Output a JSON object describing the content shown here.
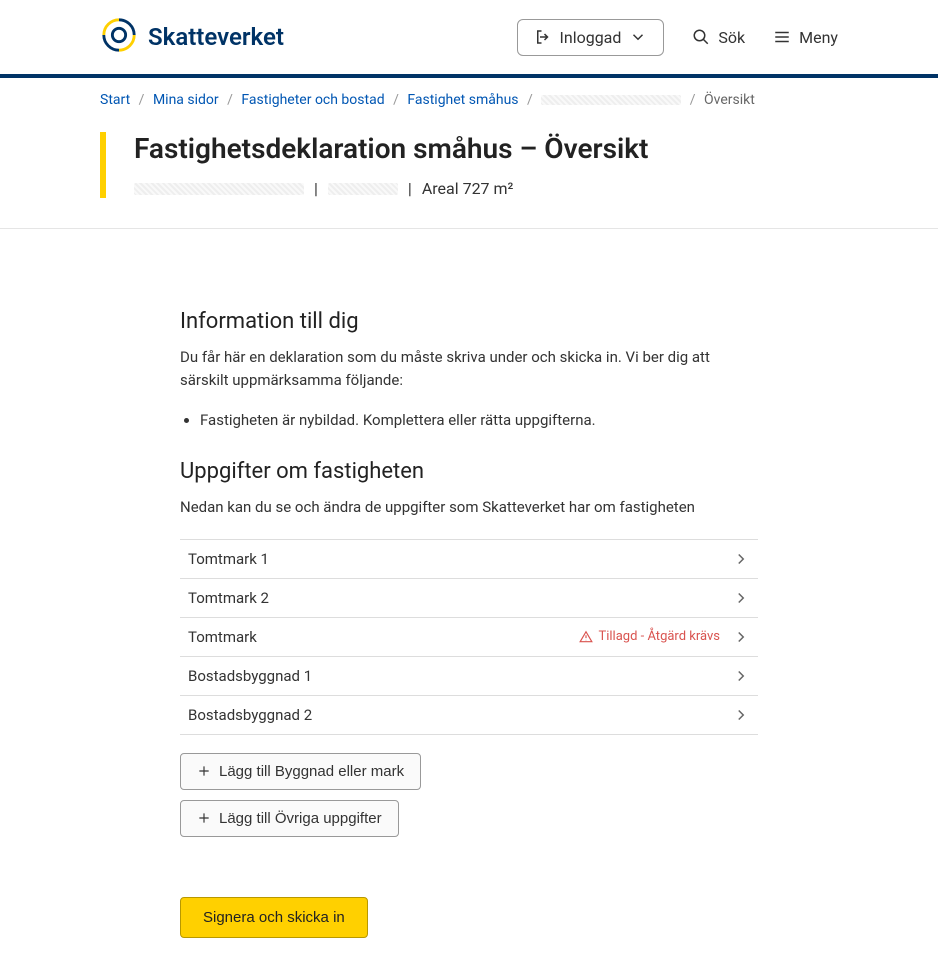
{
  "header": {
    "brand": "Skatteverket",
    "loggedin_label": "Inloggad",
    "search_label": "Sök",
    "menu_label": "Meny"
  },
  "breadcrumb": {
    "items": [
      {
        "label": "Start",
        "link": true
      },
      {
        "label": "Mina sidor",
        "link": true
      },
      {
        "label": "Fastigheter och bostad",
        "link": true
      },
      {
        "label": "Fastighet småhus",
        "link": true
      },
      {
        "label": "",
        "redacted": true
      },
      {
        "label": "Översikt",
        "link": false
      }
    ]
  },
  "title": {
    "heading": "Fastighetsdeklaration småhus – Översikt",
    "areal_label": "Areal 727 m²"
  },
  "info_section": {
    "title": "Information till dig",
    "intro": "Du får här en deklaration som du måste skriva under och skicka in. Vi ber dig att särskilt uppmärksamma följande:",
    "bullets": [
      "Fastigheten är nybildad. Komplettera eller rätta uppgifterna."
    ]
  },
  "prop_section": {
    "title": "Uppgifter om fastigheten",
    "intro": "Nedan kan du se och ändra de uppgifter som Skatteverket har om fastigheten",
    "items": [
      {
        "label": "Tomtmark 1",
        "warn": null
      },
      {
        "label": "Tomtmark 2",
        "warn": null
      },
      {
        "label": "Tomtmark",
        "warn": "Tillagd - Åtgärd krävs"
      },
      {
        "label": "Bostadsbyggnad 1",
        "warn": null
      },
      {
        "label": "Bostadsbyggnad 2",
        "warn": null
      }
    ],
    "add_building_label": "Lägg till Byggnad eller mark",
    "add_other_label": "Lägg till Övriga uppgifter"
  },
  "submit_label": "Signera och skicka in"
}
